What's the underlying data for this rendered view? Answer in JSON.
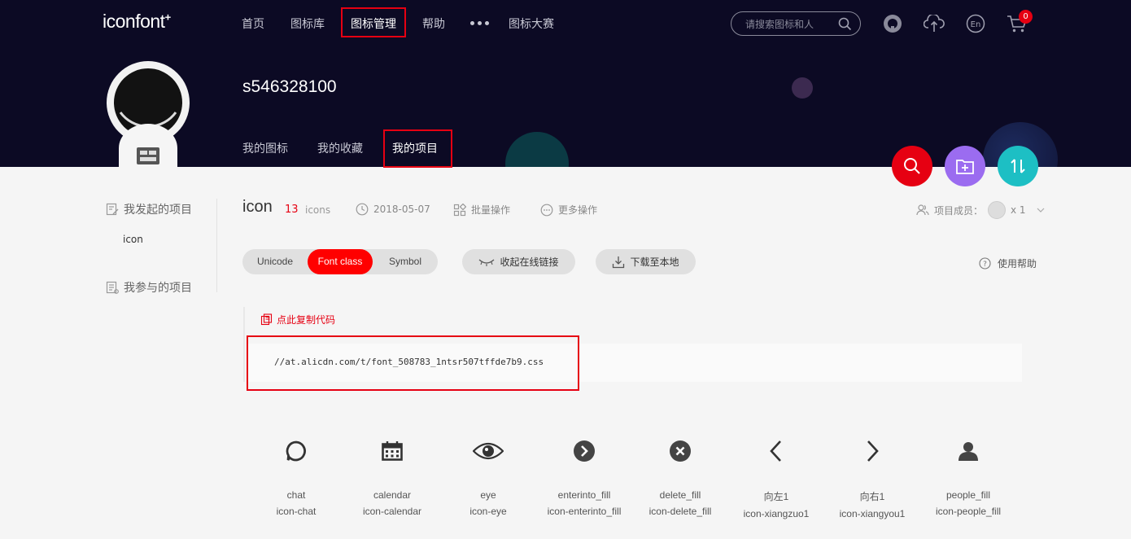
{
  "header": {
    "logo": "iconfont",
    "logo_mark": "+",
    "nav": [
      "首页",
      "图标库",
      "图标管理",
      "帮助",
      "图标大赛"
    ],
    "search_placeholder": "请搜索图标和人",
    "cart_count": "0",
    "lang_label": "En"
  },
  "profile": {
    "username": "s546328100",
    "tabs": [
      "我的图标",
      "我的收藏",
      "我的项目"
    ]
  },
  "sidebar": {
    "my_projects_title": "我发起的项目",
    "my_projects_items": [
      "icon"
    ],
    "joined_projects_title": "我参与的项目"
  },
  "project": {
    "name": "icon",
    "count": "13",
    "count_unit": "icons",
    "date": "2018-05-07",
    "batch_label": "批量操作",
    "more_label": "更多操作",
    "members_label": "项目成员：",
    "members_count": "x 1"
  },
  "tabs": {
    "options": [
      "Unicode",
      "Font class",
      "Symbol"
    ],
    "selected": "Font class"
  },
  "actions": {
    "collapse_link": "收起在线链接",
    "download": "下载至本地",
    "help": "使用帮助"
  },
  "code": {
    "copy_label": "点此复制代码",
    "url": "//at.alicdn.com/t/font_508783_1ntsr507tffde7b9.css"
  },
  "icons": [
    {
      "name": "chat",
      "class": "icon-chat",
      "icon": "chat-icon"
    },
    {
      "name": "calendar",
      "class": "icon-calendar",
      "icon": "calendar-icon"
    },
    {
      "name": "eye",
      "class": "icon-eye",
      "icon": "eye-icon"
    },
    {
      "name": "enterinto_fill",
      "class": "icon-enterinto_fill",
      "icon": "enter-fill-icon"
    },
    {
      "name": "delete_fill",
      "class": "icon-delete_fill",
      "icon": "delete-fill-icon"
    },
    {
      "name": "向左1",
      "class": "icon-xiangzuo1",
      "icon": "chevron-left-icon"
    },
    {
      "name": "向右1",
      "class": "icon-xiangyou1",
      "icon": "chevron-right-icon"
    },
    {
      "name": "people_fill",
      "class": "icon-people_fill",
      "icon": "person-icon"
    }
  ],
  "colors": {
    "header_bg": "#0c0a24",
    "accent_red": "#ff0000",
    "fab_search": "#e60012",
    "fab_folder": "#9b6cf0",
    "fab_sort": "#1dbfc4"
  }
}
